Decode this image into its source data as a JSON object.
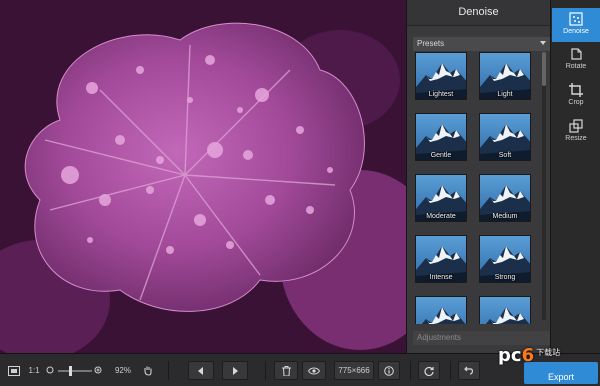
{
  "panel": {
    "title": "Denoise",
    "presets_label": "Presets",
    "adjustments_label": "Adjustments",
    "presets": [
      {
        "label": "Lightest"
      },
      {
        "label": "Light"
      },
      {
        "label": "Gentle"
      },
      {
        "label": "Soft"
      },
      {
        "label": "Moderate"
      },
      {
        "label": "Medium"
      },
      {
        "label": "Intense"
      },
      {
        "label": "Strong"
      },
      {
        "label": ""
      },
      {
        "label": ""
      }
    ]
  },
  "tools": [
    {
      "label": "Denoise",
      "icon": "denoise-icon",
      "active": true
    },
    {
      "label": "Rotate",
      "icon": "rotate-icon",
      "active": false
    },
    {
      "label": "Crop",
      "icon": "crop-icon",
      "active": false
    },
    {
      "label": "Resize",
      "icon": "resize-icon",
      "active": false
    }
  ],
  "bottom": {
    "ratio_label": "1:1",
    "zoom_value": "92%",
    "dimensions": "775×666",
    "export_label": "Export",
    "zoom_level": 0.92
  },
  "watermark": {
    "brand_p": "pc",
    "brand_six": "6",
    "brand_rest": "下载站"
  },
  "colors": {
    "accent": "#2f8bd6",
    "panel": "#3a3a3c",
    "bar": "#2b2b2d"
  }
}
